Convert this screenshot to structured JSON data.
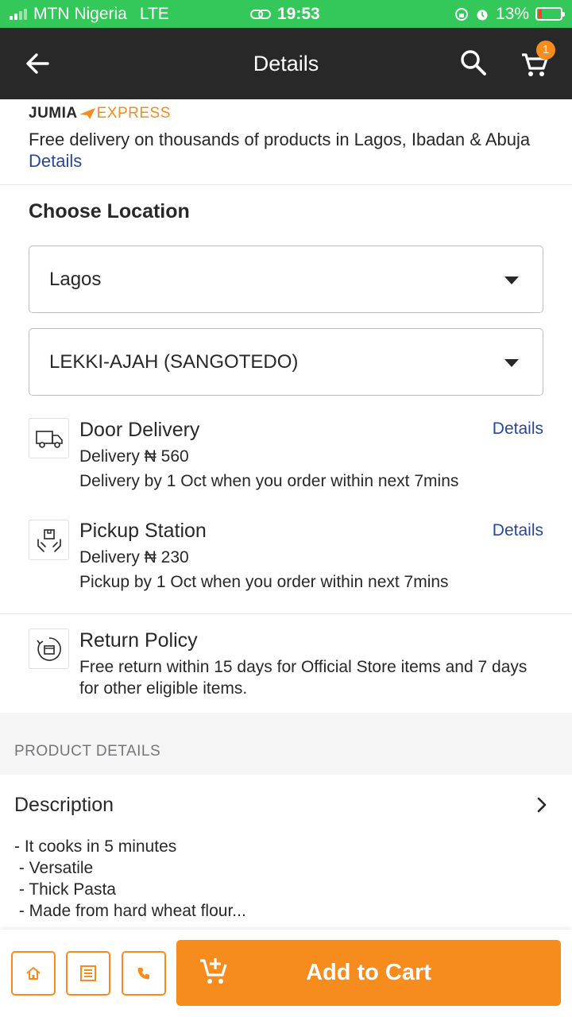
{
  "status_bar": {
    "carrier": "MTN Nigeria",
    "network": "LTE",
    "time": "19:53",
    "battery": "13%"
  },
  "header": {
    "title": "Details",
    "cart_count": "1"
  },
  "express": {
    "logo_jumia": "JUMIA",
    "logo_express": "EXPRESS",
    "text": "Free delivery on thousands of products in Lagos, Ibadan & Abuja",
    "link": "Details"
  },
  "location": {
    "heading": "Choose Location",
    "state": "Lagos",
    "area": "LEKKI-AJAH (SANGOTEDO)"
  },
  "door_delivery": {
    "title": "Door Delivery",
    "fee": "Delivery ₦ 560",
    "eta": "Delivery by 1 Oct when you order within next 7mins",
    "details": "Details"
  },
  "pickup_station": {
    "title": "Pickup Station",
    "fee": "Delivery ₦ 230",
    "eta": "Pickup by 1 Oct when you order within next 7mins",
    "details": "Details"
  },
  "return_policy": {
    "title": "Return Policy",
    "text": "Free return within 15 days for Official Store items and 7 days for other eligible items."
  },
  "product_details": {
    "section_label": "PRODUCT DETAILS",
    "description_title": "Description",
    "description": "- It cooks in 5 minutes\n - Versatile\n - Thick Pasta\n - Made from hard wheat flour..."
  },
  "bottom_bar": {
    "add_to_cart": "Add to Cart"
  },
  "colors": {
    "accent": "#f68b1e",
    "header_bg": "#282828",
    "link": "#264996",
    "status_bar": "#34c759"
  }
}
